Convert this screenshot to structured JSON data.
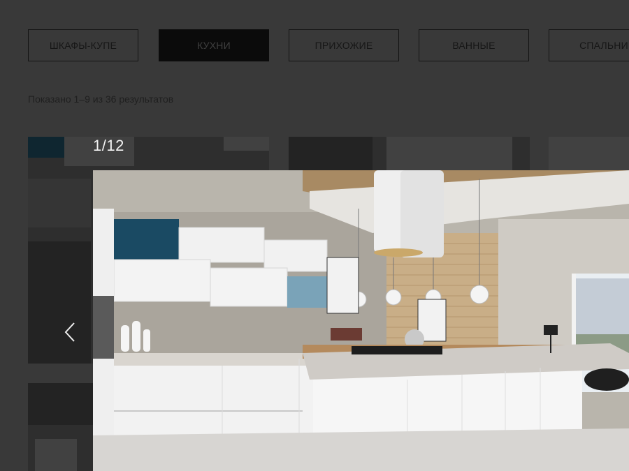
{
  "categories": [
    {
      "label": "ШКАФЫ-КУПЕ",
      "active": false
    },
    {
      "label": "КУХНИ",
      "active": true
    },
    {
      "label": "ПРИХОЖИЕ",
      "active": false
    },
    {
      "label": "ВАННЫЕ",
      "active": false
    },
    {
      "label": "СПАЛЬНИ",
      "active": false
    }
  ],
  "results": {
    "text": "Показано 1–9 из 36 результатов"
  },
  "lightbox": {
    "counter": "1/12",
    "prev_icon": "chevron-left-icon",
    "image_subject": "kitchen-photo"
  },
  "colors": {
    "overlay_bg": "#393939",
    "active_tab_bg": "#0b0b0b",
    "accent_teal": "#1a4a63",
    "counter_text": "#f2f2f2"
  }
}
